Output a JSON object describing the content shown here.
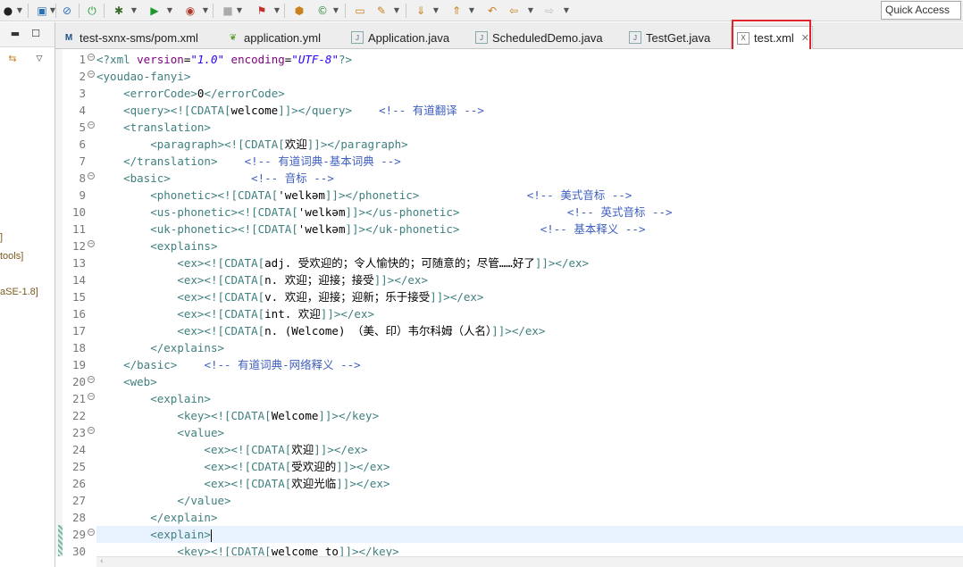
{
  "toolbar": {
    "quick_access_placeholder": "Quick Access"
  },
  "left_panel": {
    "labels": [
      "]",
      "tools]",
      "aSE-1.8]"
    ]
  },
  "tabs": [
    {
      "label": "test-sxnx-sms/pom.xml",
      "icon": "xml-m-icon",
      "active": false
    },
    {
      "label": "application.yml",
      "icon": "yml-leaf-icon",
      "active": false
    },
    {
      "label": "Application.java",
      "icon": "java-file-icon",
      "active": false
    },
    {
      "label": "ScheduledDemo.java",
      "icon": "java-file-icon",
      "active": false
    },
    {
      "label": "TestGet.java",
      "icon": "java-file-icon",
      "active": false
    },
    {
      "label": "test.xml",
      "icon": "xml-file-icon",
      "active": true
    }
  ],
  "editor": {
    "current_line": 29,
    "lines": [
      {
        "n": "1",
        "fold": true,
        "segs": [
          [
            "tag",
            "<?xml "
          ],
          [
            "attr",
            "version"
          ],
          [
            "txt",
            "="
          ],
          [
            "val",
            "\"1.0\""
          ],
          [
            "txt",
            " "
          ],
          [
            "attr",
            "encoding"
          ],
          [
            "txt",
            "="
          ],
          [
            "val",
            "\"UTF-8\""
          ],
          [
            "tag",
            "?>"
          ]
        ]
      },
      {
        "n": "2",
        "fold": true,
        "segs": [
          [
            "tag",
            "<youdao-fanyi>"
          ]
        ]
      },
      {
        "n": "3",
        "fold": false,
        "segs": [
          [
            "txt",
            "    "
          ],
          [
            "tag",
            "<errorCode>"
          ],
          [
            "txt",
            "0"
          ],
          [
            "tag",
            "</errorCode>"
          ]
        ]
      },
      {
        "n": "4",
        "fold": false,
        "segs": [
          [
            "txt",
            "    "
          ],
          [
            "tag",
            "<query>"
          ],
          [
            "cdata",
            "<![CDATA["
          ],
          [
            "txt",
            "welcome"
          ],
          [
            "cdata",
            "]]>"
          ],
          [
            "tag",
            "</query>"
          ],
          [
            "txt",
            "    "
          ],
          [
            "cmt",
            "<!-- 有道翻译 -->"
          ]
        ]
      },
      {
        "n": "5",
        "fold": true,
        "segs": [
          [
            "txt",
            "    "
          ],
          [
            "tag",
            "<translation>"
          ]
        ]
      },
      {
        "n": "6",
        "fold": false,
        "segs": [
          [
            "txt",
            "        "
          ],
          [
            "tag",
            "<paragraph>"
          ],
          [
            "cdata",
            "<![CDATA["
          ],
          [
            "txt",
            "欢迎"
          ],
          [
            "cdata",
            "]]>"
          ],
          [
            "tag",
            "</paragraph>"
          ]
        ]
      },
      {
        "n": "7",
        "fold": false,
        "segs": [
          [
            "txt",
            "    "
          ],
          [
            "tag",
            "</translation>"
          ],
          [
            "txt",
            "    "
          ],
          [
            "cmt",
            "<!-- 有道词典-基本词典 -->"
          ]
        ]
      },
      {
        "n": "8",
        "fold": true,
        "segs": [
          [
            "txt",
            "    "
          ],
          [
            "tag",
            "<basic>"
          ],
          [
            "txt",
            "            "
          ],
          [
            "cmt",
            "<!-- 音标 -->"
          ]
        ]
      },
      {
        "n": "9",
        "fold": false,
        "segs": [
          [
            "txt",
            "        "
          ],
          [
            "tag",
            "<phonetic>"
          ],
          [
            "cdata",
            "<![CDATA["
          ],
          [
            "txt",
            "'welkəm"
          ],
          [
            "cdata",
            "]]>"
          ],
          [
            "tag",
            "</phonetic>"
          ],
          [
            "txt",
            "                "
          ],
          [
            "cmt",
            "<!-- 美式音标 -->"
          ]
        ]
      },
      {
        "n": "10",
        "fold": false,
        "segs": [
          [
            "txt",
            "        "
          ],
          [
            "tag",
            "<us-phonetic>"
          ],
          [
            "cdata",
            "<![CDATA["
          ],
          [
            "txt",
            "'welkəm"
          ],
          [
            "cdata",
            "]]>"
          ],
          [
            "tag",
            "</us-phonetic>"
          ],
          [
            "txt",
            "                "
          ],
          [
            "cmt",
            "<!-- 英式音标 -->"
          ]
        ]
      },
      {
        "n": "11",
        "fold": false,
        "segs": [
          [
            "txt",
            "        "
          ],
          [
            "tag",
            "<uk-phonetic>"
          ],
          [
            "cdata",
            "<![CDATA["
          ],
          [
            "txt",
            "'welkəm"
          ],
          [
            "cdata",
            "]]>"
          ],
          [
            "tag",
            "</uk-phonetic>"
          ],
          [
            "txt",
            "            "
          ],
          [
            "cmt",
            "<!-- 基本释义 -->"
          ]
        ]
      },
      {
        "n": "12",
        "fold": true,
        "segs": [
          [
            "txt",
            "        "
          ],
          [
            "tag",
            "<explains>"
          ]
        ]
      },
      {
        "n": "13",
        "fold": false,
        "segs": [
          [
            "txt",
            "            "
          ],
          [
            "tag",
            "<ex>"
          ],
          [
            "cdata",
            "<![CDATA["
          ],
          [
            "txt",
            "adj. 受欢迎的；令人愉快的；可随意的；尽管……好了"
          ],
          [
            "cdata",
            "]]>"
          ],
          [
            "tag",
            "</ex>"
          ]
        ]
      },
      {
        "n": "14",
        "fold": false,
        "segs": [
          [
            "txt",
            "            "
          ],
          [
            "tag",
            "<ex>"
          ],
          [
            "cdata",
            "<![CDATA["
          ],
          [
            "txt",
            "n. 欢迎；迎接；接受"
          ],
          [
            "cdata",
            "]]>"
          ],
          [
            "tag",
            "</ex>"
          ]
        ]
      },
      {
        "n": "15",
        "fold": false,
        "segs": [
          [
            "txt",
            "            "
          ],
          [
            "tag",
            "<ex>"
          ],
          [
            "cdata",
            "<![CDATA["
          ],
          [
            "txt",
            "v. 欢迎，迎接；迎新；乐于接受"
          ],
          [
            "cdata",
            "]]>"
          ],
          [
            "tag",
            "</ex>"
          ]
        ]
      },
      {
        "n": "16",
        "fold": false,
        "segs": [
          [
            "txt",
            "            "
          ],
          [
            "tag",
            "<ex>"
          ],
          [
            "cdata",
            "<![CDATA["
          ],
          [
            "txt",
            "int. 欢迎"
          ],
          [
            "cdata",
            "]]>"
          ],
          [
            "tag",
            "</ex>"
          ]
        ]
      },
      {
        "n": "17",
        "fold": false,
        "segs": [
          [
            "txt",
            "            "
          ],
          [
            "tag",
            "<ex>"
          ],
          [
            "cdata",
            "<![CDATA["
          ],
          [
            "txt",
            "n. (Welcome) （美、印）韦尔科姆（人名）"
          ],
          [
            "cdata",
            "]]>"
          ],
          [
            "tag",
            "</ex>"
          ]
        ]
      },
      {
        "n": "18",
        "fold": false,
        "segs": [
          [
            "txt",
            "        "
          ],
          [
            "tag",
            "</explains>"
          ]
        ]
      },
      {
        "n": "19",
        "fold": false,
        "segs": [
          [
            "txt",
            "    "
          ],
          [
            "tag",
            "</basic>"
          ],
          [
            "txt",
            "    "
          ],
          [
            "cmt",
            "<!-- 有道词典-网络释义 -->"
          ]
        ]
      },
      {
        "n": "20",
        "fold": true,
        "segs": [
          [
            "txt",
            "    "
          ],
          [
            "tag",
            "<web>"
          ]
        ]
      },
      {
        "n": "21",
        "fold": true,
        "segs": [
          [
            "txt",
            "        "
          ],
          [
            "tag",
            "<explain>"
          ]
        ]
      },
      {
        "n": "22",
        "fold": false,
        "segs": [
          [
            "txt",
            "            "
          ],
          [
            "tag",
            "<key>"
          ],
          [
            "cdata",
            "<![CDATA["
          ],
          [
            "txt",
            "Welcome"
          ],
          [
            "cdata",
            "]]>"
          ],
          [
            "tag",
            "</key>"
          ]
        ]
      },
      {
        "n": "23",
        "fold": true,
        "segs": [
          [
            "txt",
            "            "
          ],
          [
            "tag",
            "<value>"
          ]
        ]
      },
      {
        "n": "24",
        "fold": false,
        "segs": [
          [
            "txt",
            "                "
          ],
          [
            "tag",
            "<ex>"
          ],
          [
            "cdata",
            "<![CDATA["
          ],
          [
            "txt",
            "欢迎"
          ],
          [
            "cdata",
            "]]>"
          ],
          [
            "tag",
            "</ex>"
          ]
        ]
      },
      {
        "n": "25",
        "fold": false,
        "segs": [
          [
            "txt",
            "                "
          ],
          [
            "tag",
            "<ex>"
          ],
          [
            "cdata",
            "<![CDATA["
          ],
          [
            "txt",
            "受欢迎的"
          ],
          [
            "cdata",
            "]]>"
          ],
          [
            "tag",
            "</ex>"
          ]
        ]
      },
      {
        "n": "26",
        "fold": false,
        "segs": [
          [
            "txt",
            "                "
          ],
          [
            "tag",
            "<ex>"
          ],
          [
            "cdata",
            "<![CDATA["
          ],
          [
            "txt",
            "欢迎光临"
          ],
          [
            "cdata",
            "]]>"
          ],
          [
            "tag",
            "</ex>"
          ]
        ]
      },
      {
        "n": "27",
        "fold": false,
        "segs": [
          [
            "txt",
            "            "
          ],
          [
            "tag",
            "</value>"
          ]
        ]
      },
      {
        "n": "28",
        "fold": false,
        "segs": [
          [
            "txt",
            "        "
          ],
          [
            "tag",
            "</explain>"
          ]
        ]
      },
      {
        "n": "29",
        "fold": true,
        "segs": [
          [
            "txt",
            "        "
          ],
          [
            "tag",
            "<explain>"
          ]
        ]
      },
      {
        "n": "30",
        "fold": false,
        "segs": [
          [
            "txt",
            "            "
          ],
          [
            "tag",
            "<key>"
          ],
          [
            "cdata",
            "<![CDATA["
          ],
          [
            "txt",
            "welcome to"
          ],
          [
            "cdata",
            "]]>"
          ],
          [
            "tag",
            "</key>"
          ]
        ]
      }
    ]
  }
}
